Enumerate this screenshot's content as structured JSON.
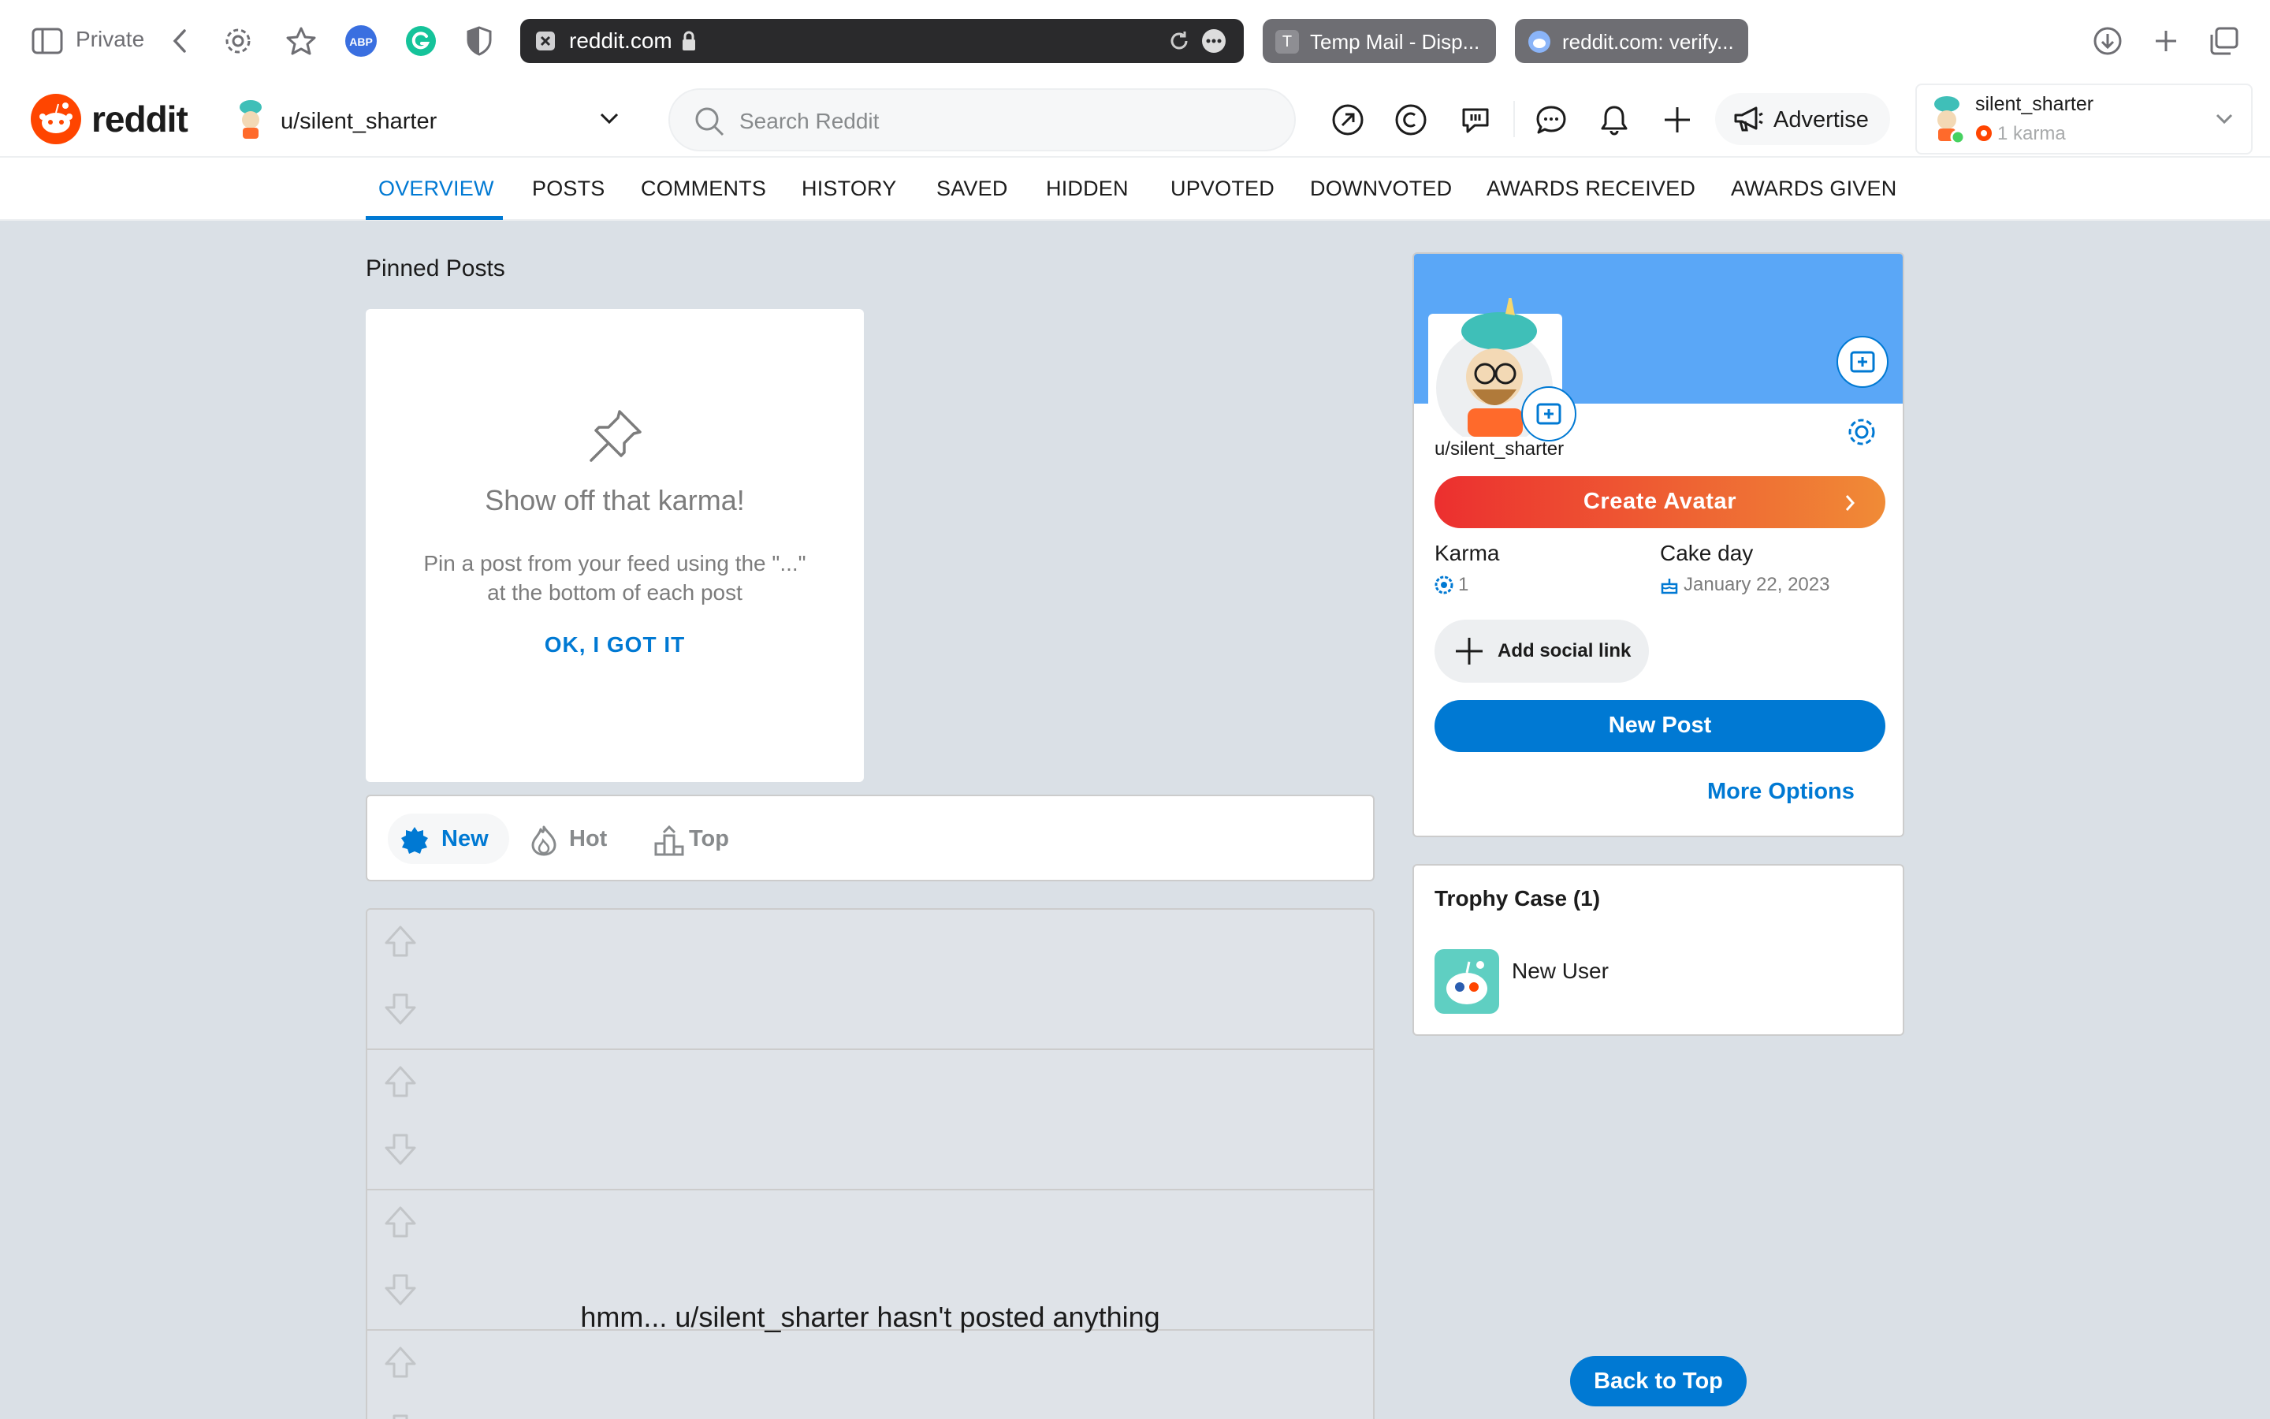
{
  "browser": {
    "private_label": "Private",
    "url": "reddit.com",
    "tabs": [
      {
        "label": "Temp Mail - Disp...",
        "favicon": "T"
      },
      {
        "label": "reddit.com: verify..."
      }
    ]
  },
  "header": {
    "logo_text": "reddit",
    "context_user": "u/silent_sharter",
    "search_placeholder": "Search Reddit",
    "advertise_label": "Advertise",
    "account": {
      "name": "silent_sharter",
      "karma": "1 karma"
    }
  },
  "profile_tabs": [
    "OVERVIEW",
    "POSTS",
    "COMMENTS",
    "HISTORY",
    "SAVED",
    "HIDDEN",
    "UPVOTED",
    "DOWNVOTED",
    "AWARDS RECEIVED",
    "AWARDS GIVEN"
  ],
  "active_tab": "OVERVIEW",
  "pinned": {
    "section_title": "Pinned Posts",
    "card_title": "Show off that karma!",
    "card_desc": "Pin a post from your feed using the \"...\" at the bottom of each post",
    "ok_label": "OK, I GOT IT"
  },
  "sort": {
    "new": "New",
    "hot": "Hot",
    "top": "Top"
  },
  "empty_message": "hmm... u/silent_sharter hasn't posted anything",
  "profile_card": {
    "username": "u/silent_sharter",
    "create_avatar": "Create Avatar",
    "karma_label": "Karma",
    "karma_value": "1",
    "cakeday_label": "Cake day",
    "cakeday_value": "January 22, 2023",
    "social_label": "Add social link",
    "new_post": "New Post",
    "more_options": "More Options"
  },
  "trophy": {
    "title": "Trophy Case (1)",
    "items": [
      "New User"
    ]
  },
  "back_to_top": "Back to Top",
  "colors": {
    "accent": "#0079d3",
    "brand": "#ff4500",
    "banner": "#5aa7f7",
    "page_bg": "#dae0e6"
  }
}
